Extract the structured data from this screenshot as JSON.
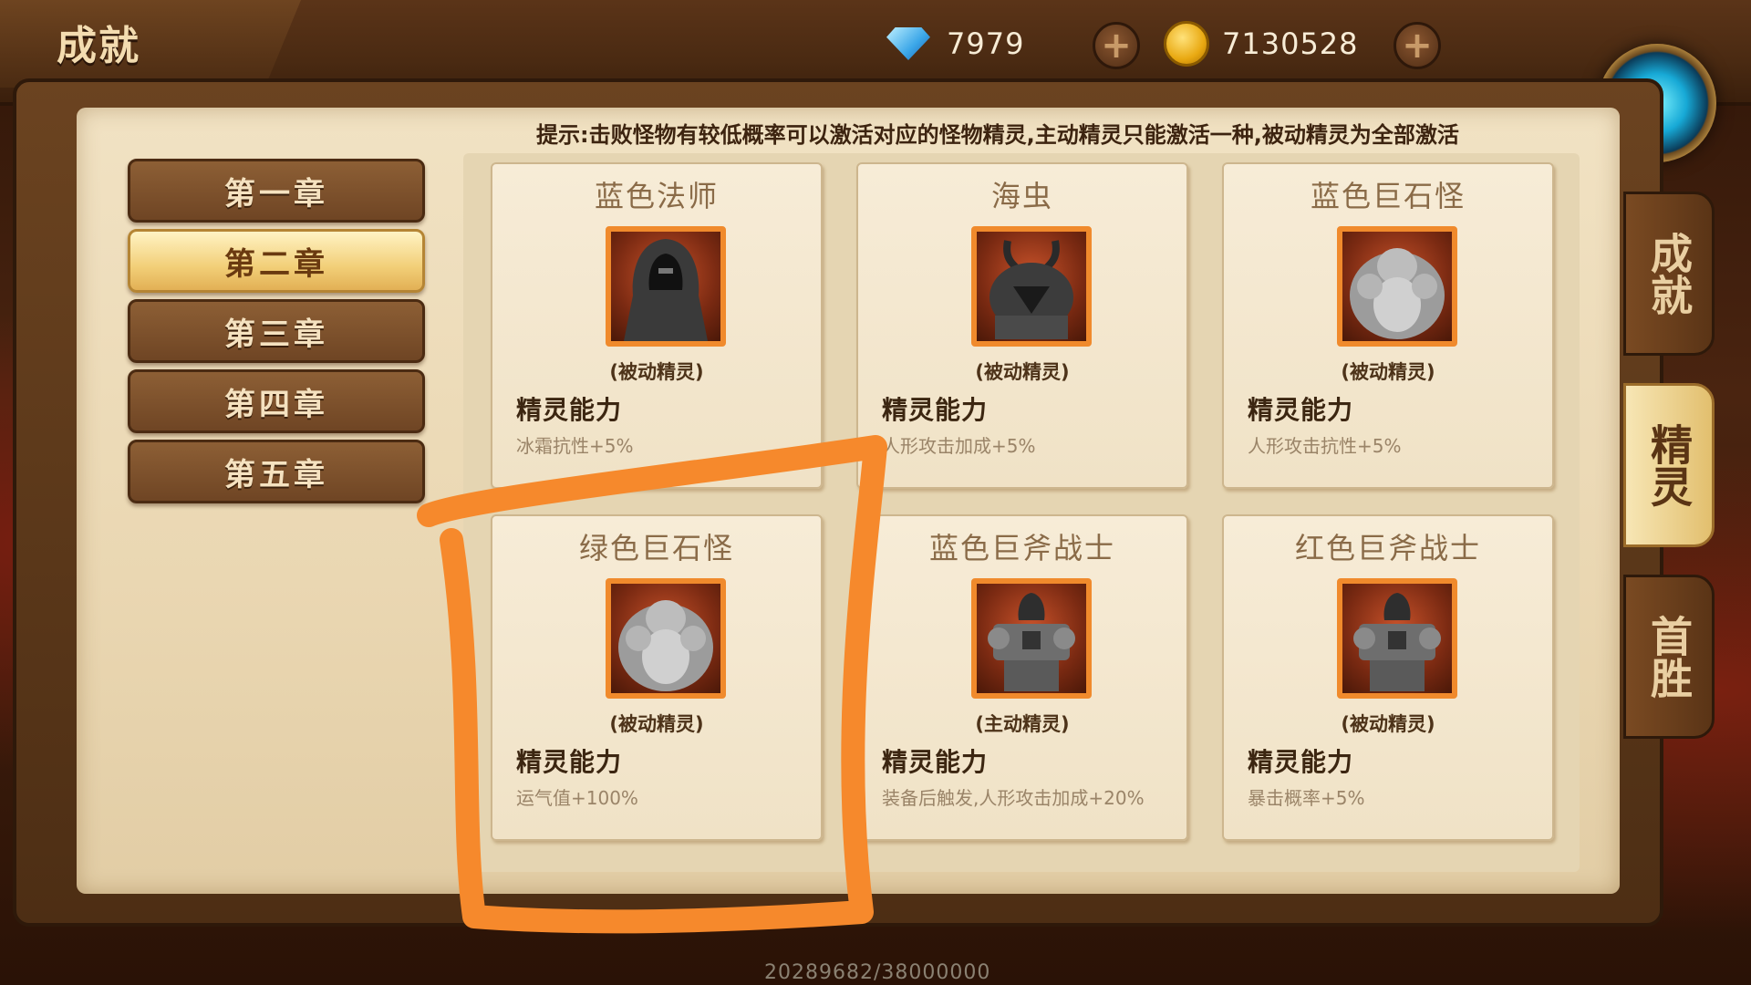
{
  "header": {
    "title": "成就",
    "diamonds": "7979",
    "gold": "7130528",
    "coin_glyph": "●"
  },
  "hint": "提示:击败怪物有较低概率可以激活对应的怪物精灵,主动精灵只能激活一种,被动精灵为全部激活",
  "chapters": [
    {
      "label": "第一章",
      "active": false
    },
    {
      "label": "第二章",
      "active": true
    },
    {
      "label": "第三章",
      "active": false
    },
    {
      "label": "第四章",
      "active": false
    },
    {
      "label": "第五章",
      "active": false
    }
  ],
  "cards": [
    {
      "name": "蓝色法师",
      "type": "(被动精灵)",
      "label": "精灵能力",
      "desc": "冰霜抗性+5%",
      "icon": "hooded-mage-icon"
    },
    {
      "name": "海虫",
      "type": "(被动精灵)",
      "label": "精灵能力",
      "desc": "人形攻击加成+5%",
      "icon": "sea-worm-icon"
    },
    {
      "name": "蓝色巨石怪",
      "type": "(被动精灵)",
      "label": "精灵能力",
      "desc": "人形攻击抗性+5%",
      "icon": "stone-golem-icon"
    },
    {
      "name": "绿色巨石怪",
      "type": "(被动精灵)",
      "label": "精灵能力",
      "desc": "运气值+100%",
      "icon": "stone-golem-icon"
    },
    {
      "name": "蓝色巨斧战士",
      "type": "(主动精灵)",
      "label": "精灵能力",
      "desc": "装备后触发,人形攻击加成+20%",
      "icon": "axe-warrior-icon"
    },
    {
      "name": "红色巨斧战士",
      "type": "(被动精灵)",
      "label": "精灵能力",
      "desc": "暴击概率+5%",
      "icon": "axe-warrior-icon"
    }
  ],
  "side_tabs": [
    {
      "label": "成就",
      "active": false
    },
    {
      "label": "精灵",
      "active": true
    },
    {
      "label": "首胜",
      "active": false
    }
  ],
  "progress": "20289682/38000000",
  "colors": {
    "accent": "#f08a2c",
    "parchment": "#f1e2c3",
    "wood": "#6b4320"
  }
}
